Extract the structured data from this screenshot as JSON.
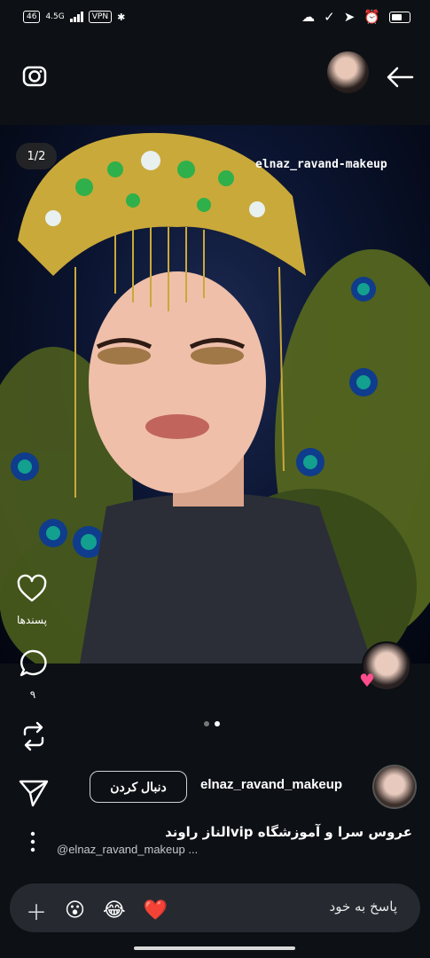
{
  "status_bar": {
    "net_badge": "46",
    "net_type": "4.5G",
    "vpn": "VPN"
  },
  "header": {
    "camera_icon": "camera-icon",
    "back_icon": "arrow-left-icon"
  },
  "post": {
    "page_counter": "1/2",
    "watermark": "elnaz_ravand-makeup",
    "carousel_active_index": 1,
    "carousel_count": 2
  },
  "actions": {
    "like_label": "پسندها",
    "comment_count": "۹",
    "like_icon": "heart-icon",
    "comment_icon": "comment-icon",
    "repost_icon": "repost-icon",
    "share_icon": "send-icon",
    "more_icon": "more-vertical-icon"
  },
  "author": {
    "username": "elnaz_ravand_makeup",
    "follow_label": "دنبال کردن",
    "caption_line1": "عروس سرا و آموزشگاه vipالناز راوند",
    "caption_line2": "@elnaz_ravand_makeup ..."
  },
  "reply": {
    "placeholder": "پاسخ به خود",
    "add_icon": "plus-icon",
    "emojis": [
      "😮",
      "😂",
      "❤️"
    ]
  },
  "colors": {
    "background": "#0d1014",
    "reply_bg": "#262a30",
    "heart_badge": "#ff4d8d"
  }
}
